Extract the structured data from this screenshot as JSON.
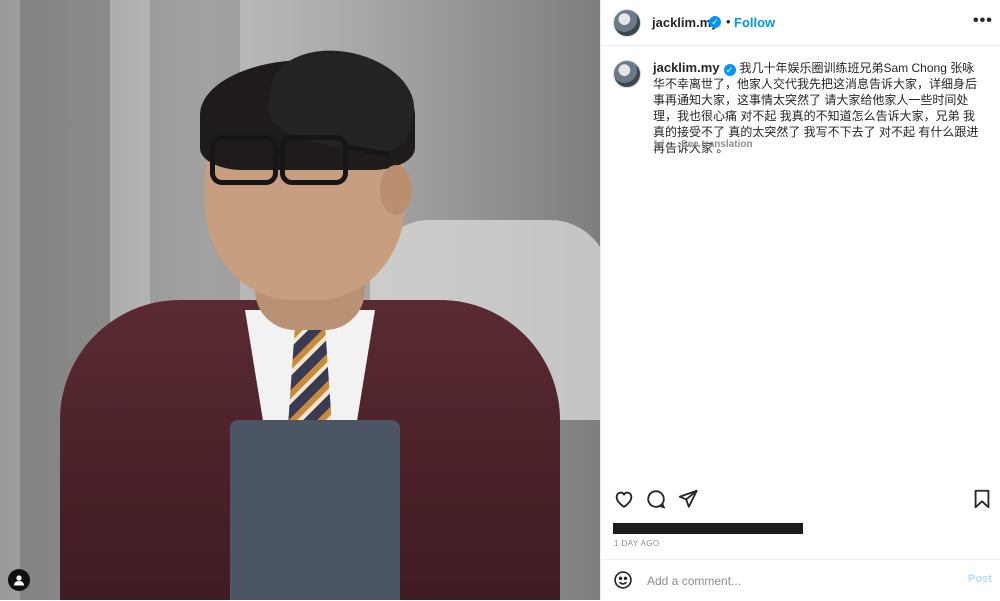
{
  "post": {
    "image_alt": "Photo of a man in glasses, beanie and burgundy velvet jacket",
    "user_tag_icon": "person-icon"
  },
  "header": {
    "username": "jacklim.my",
    "dot": "•",
    "follow_label": "Follow",
    "more_label": "•••"
  },
  "caption": {
    "username": "jacklim.my",
    "text": "我几十年娱乐圈训练班兄弟Sam Chong 张咏华不幸离世了，他家人交代我先把这消息告诉大家，详细身后事再通知大家，这事情太突然了 请大家给他家人一些时间处理，我也很心痛 对不起 我真的不知道怎么告诉大家，兄弟 我真的接受不了 真的太突然了 我写不下去了 对不起 有什么跟进再告诉大家 。",
    "age": "1d",
    "see_translation": "See translation"
  },
  "actions": {
    "like_icon": "heart-icon",
    "comment_icon": "comment-icon",
    "share_icon": "send-icon",
    "save_icon": "bookmark-icon"
  },
  "date": "1 DAY AGO",
  "comment_box": {
    "placeholder": "Add a comment...",
    "post_label": "Post"
  },
  "colors": {
    "accent": "#0095f6",
    "post_disabled": "#b2dffc"
  }
}
